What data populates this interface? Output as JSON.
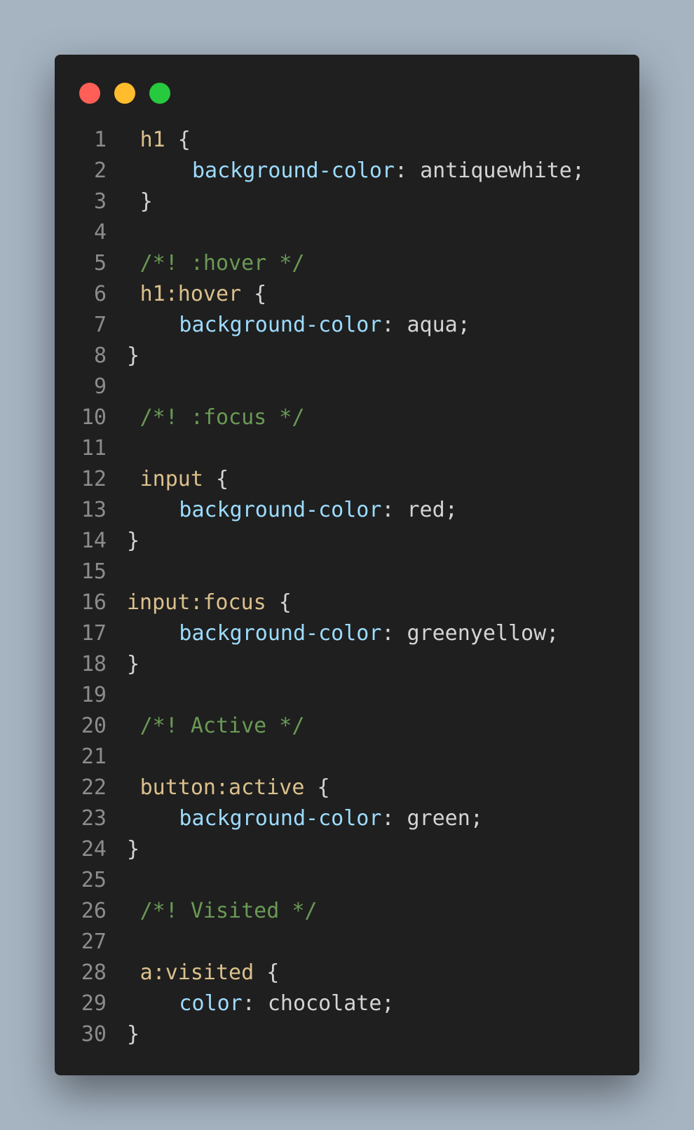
{
  "window": {
    "controls": [
      {
        "name": "close-dot",
        "color": "#ff5f56"
      },
      {
        "name": "minimize-dot",
        "color": "#ffbd2e"
      },
      {
        "name": "maximize-dot",
        "color": "#27c93f"
      }
    ]
  },
  "code": {
    "lines": [
      {
        "n": "1",
        "indent": 1,
        "tokens": [
          {
            "t": "h1",
            "c": "sel"
          },
          {
            "t": " {",
            "c": "punc"
          }
        ]
      },
      {
        "n": "2",
        "indent": 5,
        "tokens": [
          {
            "t": "background-color",
            "c": "prop"
          },
          {
            "t": ": ",
            "c": "punc"
          },
          {
            "t": "antiquewhite",
            "c": "val"
          },
          {
            "t": ";",
            "c": "punc"
          }
        ]
      },
      {
        "n": "3",
        "indent": 1,
        "tokens": [
          {
            "t": "}",
            "c": "punc"
          }
        ]
      },
      {
        "n": "4",
        "indent": 0,
        "tokens": []
      },
      {
        "n": "5",
        "indent": 1,
        "tokens": [
          {
            "t": "/*! :hover */",
            "c": "cmt"
          }
        ]
      },
      {
        "n": "6",
        "indent": 1,
        "tokens": [
          {
            "t": "h1:hover",
            "c": "sel"
          },
          {
            "t": " {",
            "c": "punc"
          }
        ]
      },
      {
        "n": "7",
        "indent": 4,
        "tokens": [
          {
            "t": "background-color",
            "c": "prop"
          },
          {
            "t": ": ",
            "c": "punc"
          },
          {
            "t": "aqua",
            "c": "val"
          },
          {
            "t": ";",
            "c": "punc"
          }
        ]
      },
      {
        "n": "8",
        "indent": 0,
        "tokens": [
          {
            "t": "}",
            "c": "punc"
          }
        ]
      },
      {
        "n": "9",
        "indent": 0,
        "tokens": []
      },
      {
        "n": "10",
        "indent": 1,
        "tokens": [
          {
            "t": "/*! :focus */",
            "c": "cmt"
          }
        ]
      },
      {
        "n": "11",
        "indent": 0,
        "tokens": []
      },
      {
        "n": "12",
        "indent": 1,
        "tokens": [
          {
            "t": "input",
            "c": "sel"
          },
          {
            "t": " {",
            "c": "punc"
          }
        ]
      },
      {
        "n": "13",
        "indent": 4,
        "tokens": [
          {
            "t": "background-color",
            "c": "prop"
          },
          {
            "t": ": ",
            "c": "punc"
          },
          {
            "t": "red",
            "c": "val"
          },
          {
            "t": ";",
            "c": "punc"
          }
        ]
      },
      {
        "n": "14",
        "indent": 0,
        "tokens": [
          {
            "t": "}",
            "c": "punc"
          }
        ]
      },
      {
        "n": "15",
        "indent": 0,
        "tokens": []
      },
      {
        "n": "16",
        "indent": 0,
        "tokens": [
          {
            "t": "input:focus",
            "c": "sel"
          },
          {
            "t": " {",
            "c": "punc"
          }
        ]
      },
      {
        "n": "17",
        "indent": 4,
        "tokens": [
          {
            "t": "background-color",
            "c": "prop"
          },
          {
            "t": ": ",
            "c": "punc"
          },
          {
            "t": "greenyellow",
            "c": "val"
          },
          {
            "t": ";",
            "c": "punc"
          }
        ]
      },
      {
        "n": "18",
        "indent": 0,
        "tokens": [
          {
            "t": "}",
            "c": "punc"
          }
        ]
      },
      {
        "n": "19",
        "indent": 0,
        "tokens": []
      },
      {
        "n": "20",
        "indent": 1,
        "tokens": [
          {
            "t": "/*! Active */",
            "c": "cmt"
          }
        ]
      },
      {
        "n": "21",
        "indent": 0,
        "tokens": []
      },
      {
        "n": "22",
        "indent": 1,
        "tokens": [
          {
            "t": "button:active",
            "c": "sel"
          },
          {
            "t": " {",
            "c": "punc"
          }
        ]
      },
      {
        "n": "23",
        "indent": 4,
        "tokens": [
          {
            "t": "background-color",
            "c": "prop"
          },
          {
            "t": ": ",
            "c": "punc"
          },
          {
            "t": "green",
            "c": "val"
          },
          {
            "t": ";",
            "c": "punc"
          }
        ]
      },
      {
        "n": "24",
        "indent": 0,
        "tokens": [
          {
            "t": "}",
            "c": "punc"
          }
        ]
      },
      {
        "n": "25",
        "indent": 0,
        "tokens": []
      },
      {
        "n": "26",
        "indent": 1,
        "tokens": [
          {
            "t": "/*! Visited */",
            "c": "cmt"
          }
        ]
      },
      {
        "n": "27",
        "indent": 0,
        "tokens": []
      },
      {
        "n": "28",
        "indent": 1,
        "tokens": [
          {
            "t": "a:visited",
            "c": "sel"
          },
          {
            "t": " {",
            "c": "punc"
          }
        ]
      },
      {
        "n": "29",
        "indent": 4,
        "tokens": [
          {
            "t": "color",
            "c": "prop"
          },
          {
            "t": ": ",
            "c": "punc"
          },
          {
            "t": "chocolate",
            "c": "val"
          },
          {
            "t": ";",
            "c": "punc"
          }
        ]
      },
      {
        "n": "30",
        "indent": 0,
        "tokens": [
          {
            "t": "}",
            "c": "punc"
          }
        ]
      }
    ]
  }
}
